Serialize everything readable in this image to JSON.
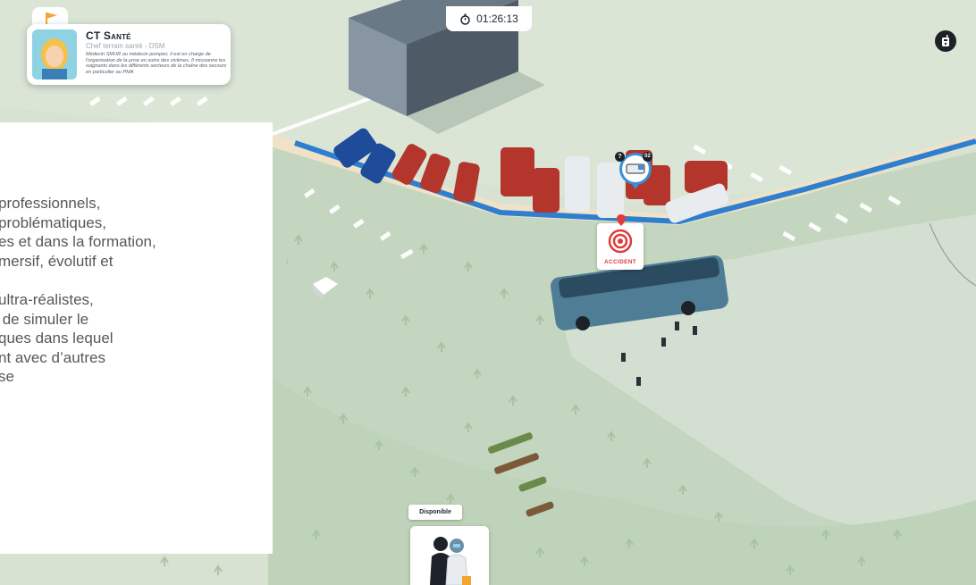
{
  "hud": {
    "timer": "01:26:13"
  },
  "role_card": {
    "title": "CT Santé",
    "subtitle": "Chef terrain santé - DSM",
    "description": "Médecin SMUR ou médecin pompier, il est en charge de l'organisation de la prise en soins des victimes. Il missionne les soignants dans les différents secteurs de la chaîne des secours en particulier au PMA"
  },
  "overlay": {
    "text": "professionnels,\nproblématiques,\nes et dans la formation,\nmersif, évolutif et\n\nultra-réalistes,\n de simuler le\nques dans lequel\nnt avec d’autres\nse"
  },
  "map": {
    "accident_label": "ACCIDENT",
    "pin_badge_left": "?",
    "pin_badge_right": "02"
  },
  "unit_card": {
    "status": "Disponible"
  },
  "colors": {
    "grass": "#c7d8c2",
    "hill": "#dfe6df",
    "road": "#efe2c8",
    "route_blue": "#2f7fd0",
    "accent_red": "#e03a3a"
  }
}
